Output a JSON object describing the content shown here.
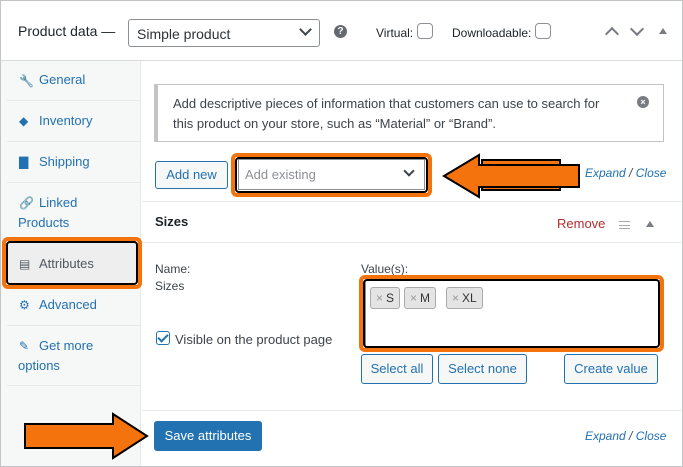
{
  "header": {
    "title": "Product data —",
    "product_type": "Simple product",
    "help_icon": "?",
    "virtual_label": "Virtual:",
    "downloadable_label": "Downloadable:"
  },
  "sidebar": {
    "items": [
      {
        "label": "General",
        "icon": "wrench-icon",
        "glyph": "🔧"
      },
      {
        "label": "Inventory",
        "icon": "tag-icon",
        "glyph": "◆"
      },
      {
        "label": "Shipping",
        "icon": "truck-icon",
        "glyph": "▇"
      },
      {
        "label": "Linked",
        "label2": "Products",
        "icon": "link-icon",
        "glyph": "🔗"
      },
      {
        "label": "Attributes",
        "icon": "list-icon",
        "glyph": "▤"
      },
      {
        "label": "Advanced",
        "icon": "gear-icon",
        "glyph": "⚙"
      },
      {
        "label": "Get more",
        "label2": "options",
        "icon": "plugin-icon",
        "glyph": "✎"
      }
    ],
    "active": "Attributes"
  },
  "notice": {
    "line1": "Add descriptive pieces of information that customers can use to search for",
    "line2": "this product on your store, such as “Material” or “Brand”.",
    "close_icon": "×"
  },
  "toolbar": {
    "add_new": "Add new",
    "add_existing_placeholder": "Add existing",
    "expand": "Expand",
    "slash": "/",
    "close": "Close"
  },
  "callout": {
    "text": "Sizes"
  },
  "attribute": {
    "title": "Sizes",
    "remove": "Remove",
    "name_label": "Name:",
    "name_value": "Sizes",
    "values_label": "Value(s):",
    "values": [
      "S",
      "M",
      "XL"
    ],
    "token_x": "×",
    "visible_label": "Visible on the product page",
    "visible_checked": true,
    "select_all": "Select all",
    "select_none": "Select none",
    "create_value": "Create value"
  },
  "footer": {
    "save": "Save attributes",
    "expand": "Expand",
    "slash": "/",
    "close": "Close"
  },
  "colors": {
    "accent": "#2271b1",
    "highlight": "#f5730c",
    "remove": "#b32d2e"
  }
}
